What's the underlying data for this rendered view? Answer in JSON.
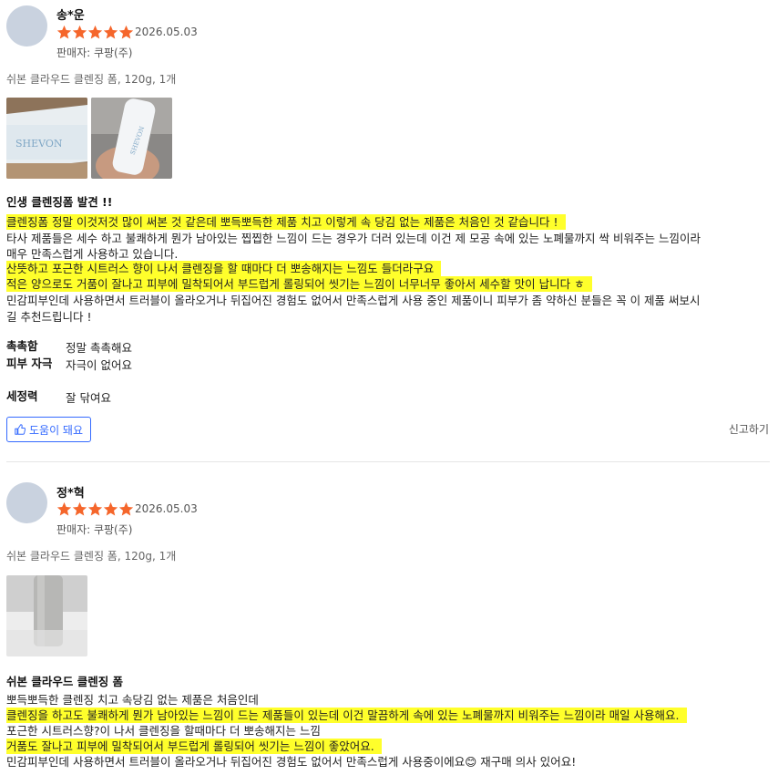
{
  "reviews": [
    {
      "reviewer": "송*운",
      "rating": 5,
      "date": "2026.05.03",
      "seller": "판매자: 쿠팡(주)",
      "product": "쉬본 클라우드 클렌징 폼, 120g, 1개",
      "headline": "인생 클렌징폼 발견 !!",
      "body": [
        {
          "text": "클렌징폼 정말 이것저것 많이 써본 것 같은데 뽀득뽀득한 제품 치고 이렇게 속 당김 없는 제품은 처음인 것 같습니다 !",
          "highlight": true
        },
        {
          "text": "타사 제품들은 세수 하고 불쾌하게 뭔가 남아있는 찝찝한 느낌이 드는 경우가 더러 있는데 이건 제 모공 속에 있는 노폐물까지 싹 비워주는 느낌이라",
          "highlight": false
        },
        {
          "text": "매우 만족스럽게 사용하고 있습니다.",
          "highlight": false
        },
        {
          "text": "산뜻하고 포근한 시트러스 향이 나서 클렌징을 할 때마다 더 뽀송해지는 느낌도 들더라구요",
          "highlight": true
        },
        {
          "text": "적은 양으로도 거품이 잘나고 피부에 밀착되어서 부드럽게 롤링되어 씻기는 느낌이 너무너무 좋아서 세수할 맛이 납니다 ㅎ",
          "highlight": true
        },
        {
          "text": "민감피부인데 사용하면서 트러블이 올라오거나 뒤집어진 경험도 없어서 만족스럽게 사용 중인 제품이니 피부가 좀 약하신 분들은 꼭 이 제품 써보시",
          "highlight": false
        },
        {
          "text": "길 추천드립니다 !",
          "highlight": false
        }
      ],
      "attributes": [
        {
          "label": "촉촉함",
          "value": "정말 촉촉해요"
        },
        {
          "label": "피부 자극",
          "value": "자극이 없어요"
        },
        {
          "label": "세정력",
          "value": "잘 닦여요"
        }
      ],
      "helpful_label": "도움이 돼요",
      "report_label": "신고하기"
    },
    {
      "reviewer": "정*혁",
      "rating": 5,
      "date": "2026.05.03",
      "seller": "판매자: 쿠팡(주)",
      "product": "쉬본 클라우드 클렌징 폼, 120g, 1개",
      "headline": "쉬본 클라우드 클렌징 폼",
      "body": [
        {
          "text": "뽀득뽀득한 클렌징 치고 속당김 없는 제품은 처음인데",
          "highlight": false
        },
        {
          "text": "클렌징을 하고도 불쾌하게 뭔가 남아있는 느낌이 드는 제품들이 있는데 이건 말끔하게 속에 있는 노폐물까지 비워주는 느낌이라 매일 사용해요.",
          "highlight": true
        },
        {
          "text": "포근한 시트러스향?이 나서 클렌징을 할때마다 더 뽀송해지는 느낌",
          "highlight": false
        },
        {
          "text": "거품도 잘나고 피부에 밀착되어서 부드럽게 롤링되어 씻기는 느낌이 좋았어요.",
          "highlight": true
        },
        {
          "text": "민감피부인데 사용하면서 트러블이 올라오거나 뒤집어진 경험도 없어서 만족스럽게 사용중이에요😊 재구매 의사 있어요!",
          "highlight": false
        }
      ]
    }
  ],
  "colors": {
    "star": "#f5662b",
    "highlight": "#ffff2b",
    "accent": "#346aff"
  }
}
